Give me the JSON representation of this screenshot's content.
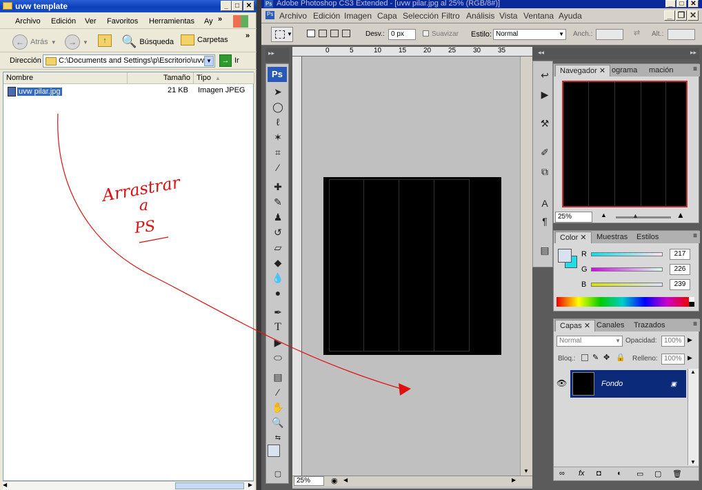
{
  "explorer": {
    "title": "uvw template",
    "menu": [
      "Archivo",
      "Edición",
      "Ver",
      "Favoritos",
      "Herramientas",
      "Ay"
    ],
    "toolbar": {
      "back": "Atrás",
      "search": "Búsqueda",
      "folders": "Carpetas"
    },
    "address_label": "Dirección",
    "address_value": "C:\\Documents and Settings\\p\\Escritorio\\uvw",
    "go_label": "Ir",
    "columns": [
      "Nombre",
      "Tamaño",
      "Tipo"
    ],
    "files": [
      {
        "name": "uvw pilar.jpg",
        "size": "21 KB",
        "type": "Imagen JPEG"
      }
    ]
  },
  "annotation": {
    "line1": "Arrastrar",
    "line2": "a",
    "line3": "PS",
    "color": "#e01010"
  },
  "photoshop": {
    "title": "Adobe Photoshop CS3 Extended - [uvw pilar.jpg al 25% (RGB/8#)]",
    "menu": [
      "Archivo",
      "Edición",
      "Imagen",
      "Capa",
      "Selección",
      "Filtro",
      "Análisis",
      "Vista",
      "Ventana",
      "Ayuda"
    ],
    "options": {
      "feather_label": "Desv.:",
      "feather_value": "0 px",
      "antialias_label": "Suavizar",
      "style_label": "Estilo:",
      "style_value": "Normal",
      "width_label": "Anch.:",
      "height_label": "Alt.:"
    },
    "ps_logo": "Ps",
    "ruler_ticks": [
      "0",
      "5",
      "10",
      "15",
      "20",
      "25",
      "30",
      "35"
    ],
    "zoom": "25%",
    "navigator": {
      "tabs": [
        "Navegador",
        "ograma",
        "mación"
      ],
      "zoom": "25%"
    },
    "color": {
      "tabs": [
        "Color",
        "Muestras",
        "Estilos"
      ],
      "r_label": "R",
      "g_label": "G",
      "b_label": "B",
      "r": "217",
      "g": "226",
      "b": "239",
      "fg_color": "#d9e2ef",
      "bg_color": "#22dde8"
    },
    "layers": {
      "tabs": [
        "Capas",
        "Canales",
        "Trazados"
      ],
      "blend": "Normal",
      "opacity_label": "Opacidad:",
      "opacity": "100%",
      "lock_label": "Bloq.:",
      "fill_label": "Relleno:",
      "fill": "100%",
      "layer_name": "Fondo"
    }
  }
}
